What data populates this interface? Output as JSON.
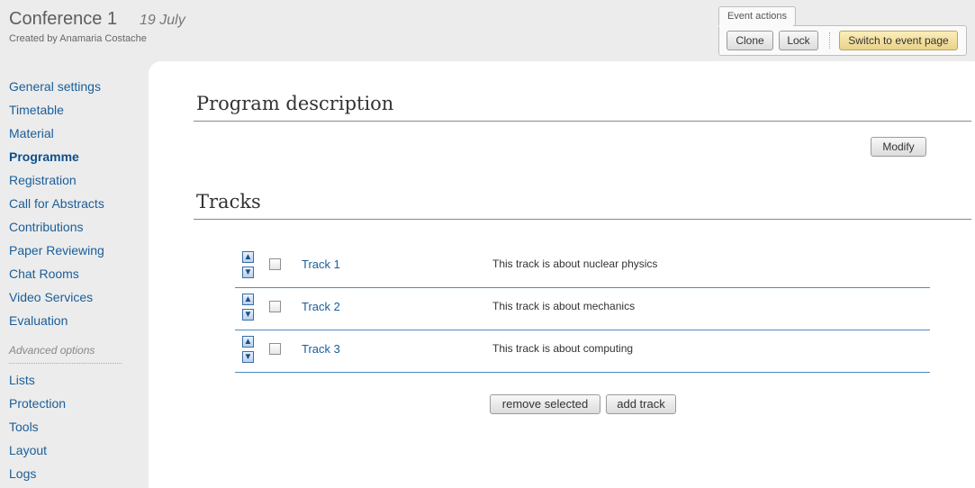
{
  "header": {
    "title": "Conference 1",
    "date": "19 July",
    "creator": "Created by Anamaria Costache"
  },
  "event_actions": {
    "label": "Event actions",
    "clone": "Clone",
    "lock": "Lock",
    "switch": "Switch to event page"
  },
  "sidebar": {
    "items": [
      {
        "label": "General settings"
      },
      {
        "label": "Timetable"
      },
      {
        "label": "Material"
      },
      {
        "label": "Programme",
        "active": true
      },
      {
        "label": "Registration"
      },
      {
        "label": "Call for Abstracts"
      },
      {
        "label": "Contributions"
      },
      {
        "label": "Paper Reviewing"
      },
      {
        "label": "Chat Rooms"
      },
      {
        "label": "Video Services"
      },
      {
        "label": "Evaluation"
      }
    ],
    "advanced_label": "Advanced options",
    "advanced_items": [
      {
        "label": "Lists"
      },
      {
        "label": "Protection"
      },
      {
        "label": "Tools"
      },
      {
        "label": "Layout"
      },
      {
        "label": "Logs"
      }
    ]
  },
  "program": {
    "title": "Program description",
    "modify": "Modify"
  },
  "tracks": {
    "title": "Tracks",
    "rows": [
      {
        "name": "Track 1",
        "description": "This track is about nuclear physics"
      },
      {
        "name": "Track 2",
        "description": "This track is about mechanics"
      },
      {
        "name": "Track 3",
        "description": "This track is about computing"
      }
    ],
    "remove_selected": "remove selected",
    "add_track": "add track"
  },
  "colors": {
    "link": "#1a5e99",
    "highlight_button": "#f3dea0",
    "row_separator": "#4f8ac0"
  }
}
